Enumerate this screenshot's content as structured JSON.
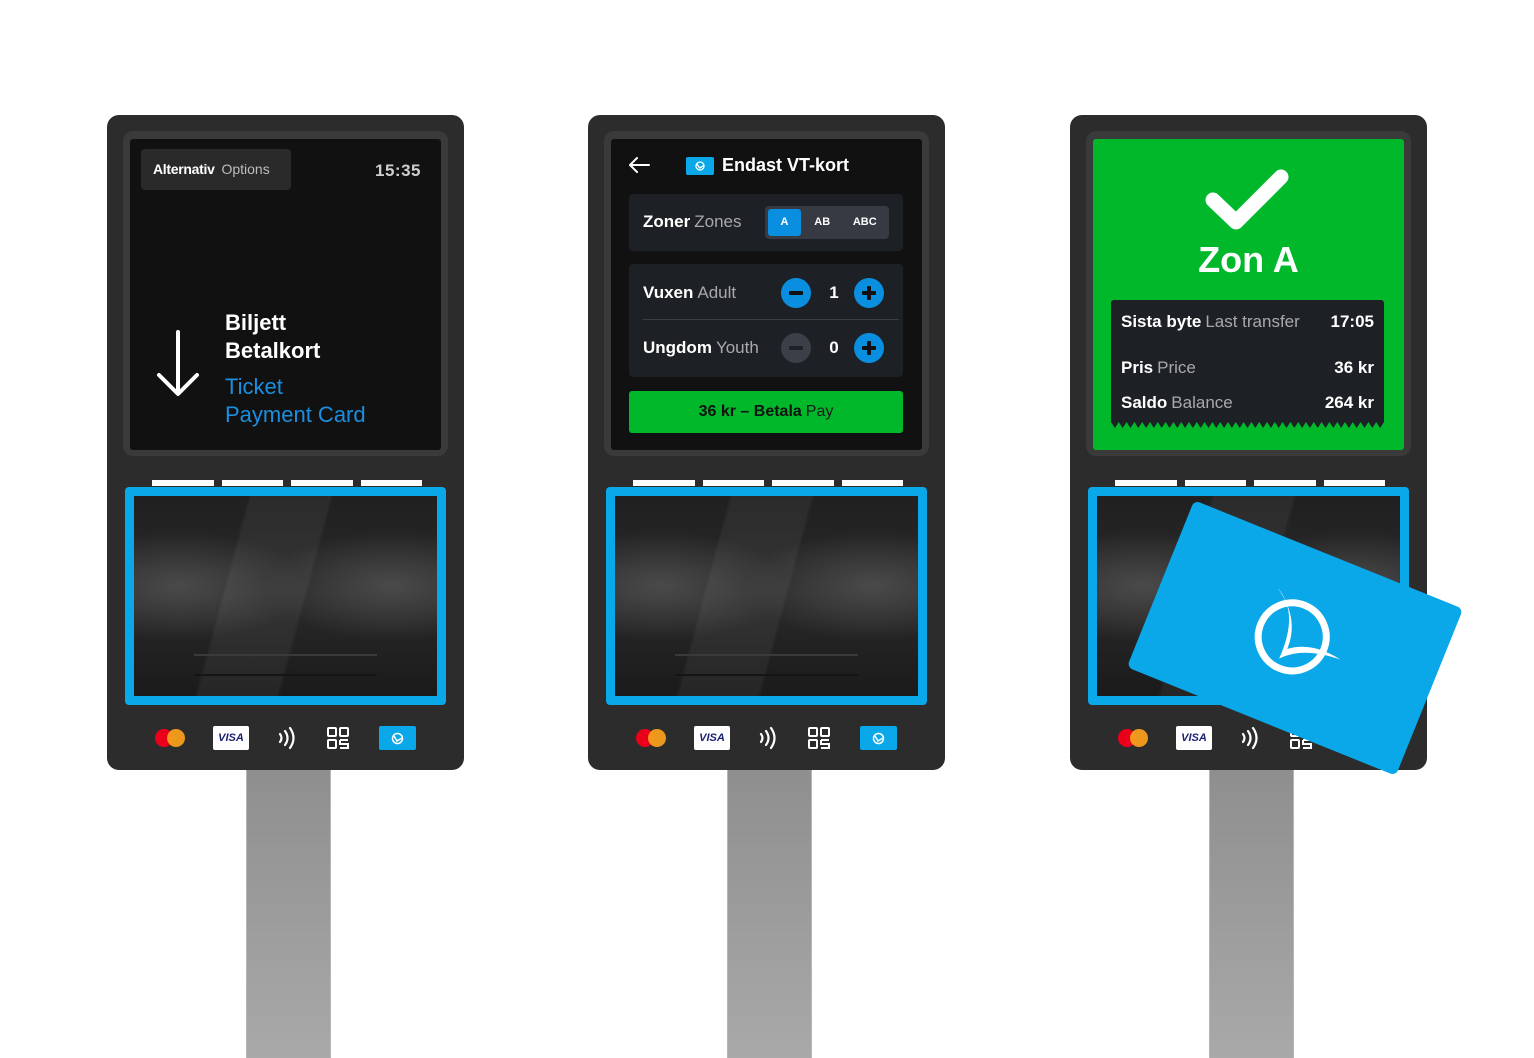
{
  "kiosks": [
    {
      "screen": "start",
      "options_button": {
        "sv": "Alternativ",
        "en": "Options"
      },
      "clock": "15:35",
      "instruction": {
        "sv_lines": [
          "Biljett",
          "Betalkort"
        ],
        "en_lines": [
          "Ticket",
          "Payment Card"
        ],
        "icon": "arrow-down-icon"
      }
    },
    {
      "screen": "purchase",
      "header": {
        "back_icon": "arrow-left-icon",
        "chip_icon": "vt-card-icon",
        "title": "Endast VT-kort"
      },
      "zones": {
        "label_sv": "Zoner",
        "label_en": "Zones",
        "options": [
          "A",
          "AB",
          "ABC"
        ],
        "selected": "A"
      },
      "passengers": [
        {
          "sv": "Vuxen",
          "en": "Adult",
          "count": "1",
          "minus_enabled": true
        },
        {
          "sv": "Ungdom",
          "en": "Youth",
          "count": "0",
          "minus_enabled": false
        }
      ],
      "pay_button": {
        "sv": "36 kr – Betala",
        "en": "Pay"
      }
    },
    {
      "screen": "confirmation",
      "status_icon": "checkmark-icon",
      "title": "Zon A",
      "receipt": [
        {
          "sv": "Sista byte",
          "en": "Last transfer",
          "value": "17:05"
        },
        {
          "sv": "Pris",
          "en": "Price",
          "value": "36 kr"
        },
        {
          "sv": "Saldo",
          "en": "Balance",
          "value": "264 kr"
        }
      ]
    }
  ],
  "payment_methods": [
    {
      "name": "Mastercard",
      "icon": "mastercard-icon"
    },
    {
      "name": "VISA",
      "icon": "visa-icon",
      "label": "VISA"
    },
    {
      "name": "Contactless",
      "icon": "contactless-icon"
    },
    {
      "name": "QR code",
      "icon": "qr-code-icon"
    },
    {
      "name": "VT-kort",
      "icon": "vt-card-icon"
    }
  ],
  "colors": {
    "accent_blue": "#0aa8e8",
    "button_blue": "#0a8fe0",
    "success_green": "#00b82a",
    "kiosk_body": "#2c2c2c",
    "screen_bg": "#111111"
  }
}
